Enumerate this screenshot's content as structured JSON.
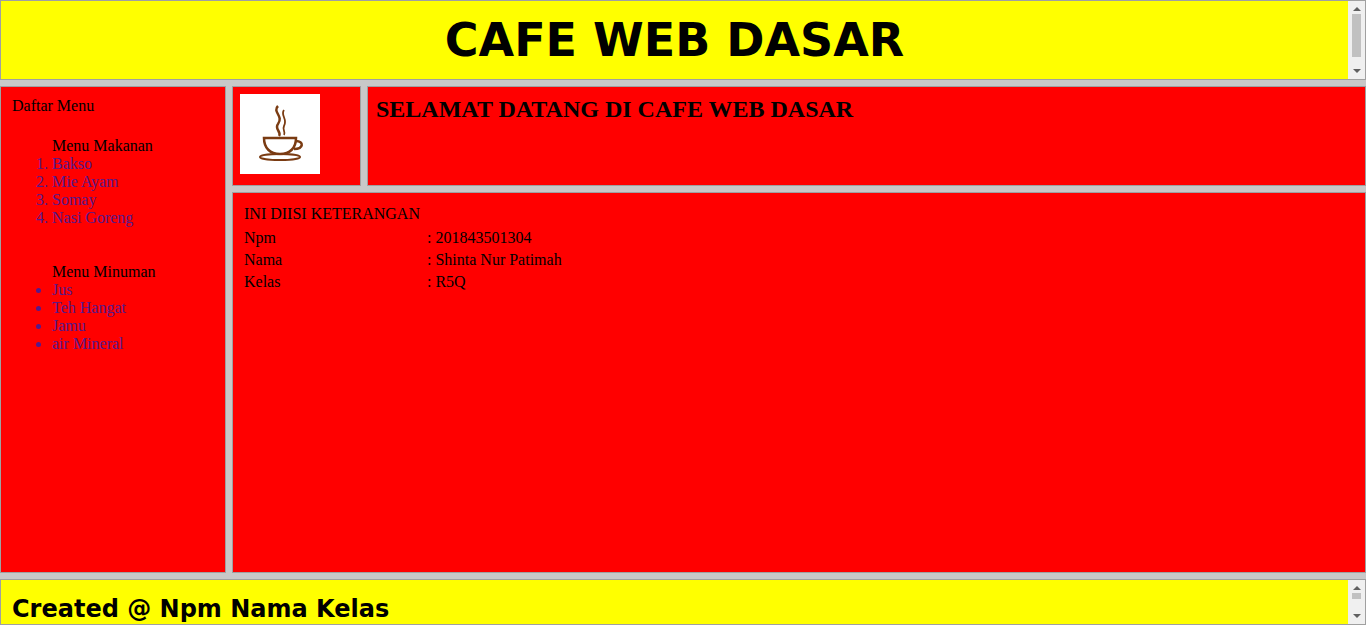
{
  "header": {
    "title": "CAFE WEB DASAR",
    "scrollbar": {
      "level": 0.82
    }
  },
  "sidebar": {
    "title": "Daftar Menu",
    "groups": [
      {
        "title": "Menu Makanan",
        "kind": "ordered",
        "items": [
          "Bakso",
          "Mie Ayam",
          "Somay",
          "Nasi Goreng"
        ]
      },
      {
        "title": "Menu Minuman",
        "kind": "unordered",
        "items": [
          "Jus",
          "Teh Hangat",
          "Jamu",
          "air Mineral"
        ]
      }
    ]
  },
  "banner": {
    "title": "SELAMAT DATANG DI CAFE WEB DASAR"
  },
  "content": {
    "heading": "INI DIISI KETERANGAN",
    "rows": [
      [
        "Npm",
        ": 201843501304"
      ],
      [
        "Nama",
        ": Shinta Nur Patimah"
      ],
      [
        "Kelas",
        ": R5Q"
      ]
    ]
  },
  "footer": {
    "text": "Created @ Npm Nama Kelas",
    "scrollbar": {
      "level": 0.35
    }
  }
}
